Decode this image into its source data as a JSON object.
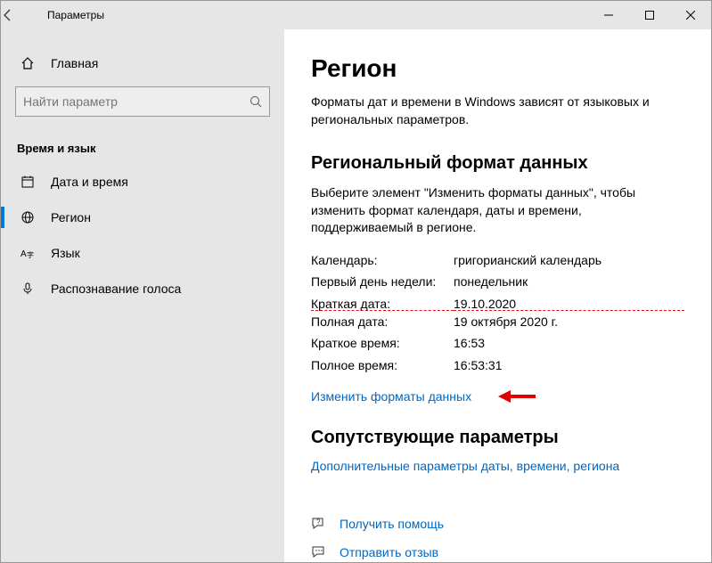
{
  "titlebar": {
    "title": "Параметры"
  },
  "sidebar": {
    "home": "Главная",
    "search_placeholder": "Найти параметр",
    "group": "Время и язык",
    "items": [
      {
        "label": "Дата и время"
      },
      {
        "label": "Регион"
      },
      {
        "label": "Язык"
      },
      {
        "label": "Распознавание голоса"
      }
    ]
  },
  "content": {
    "heading": "Регион",
    "intro": "Форматы дат и времени в Windows зависят от языковых и региональных параметров.",
    "section_title": "Региональный формат данных",
    "section_desc": "Выберите элемент \"Изменить форматы данных\", чтобы изменить формат календаря, даты и времени, поддерживаемый в регионе.",
    "rows": [
      {
        "k": "Календарь:",
        "v": "григорианский календарь"
      },
      {
        "k": "Первый день недели:",
        "v": "понедельник"
      },
      {
        "k": "Краткая дата:",
        "v": "19.10.2020"
      },
      {
        "k": "Полная дата:",
        "v": "19 октября 2020 г."
      },
      {
        "k": "Краткое время:",
        "v": "16:53"
      },
      {
        "k": "Полное время:",
        "v": "16:53:31"
      }
    ],
    "change_link": "Изменить форматы данных",
    "related_title": "Сопутствующие параметры",
    "related_link": "Дополнительные параметры даты, времени, региона",
    "help": "Получить помощь",
    "feedback": "Отправить отзыв"
  }
}
